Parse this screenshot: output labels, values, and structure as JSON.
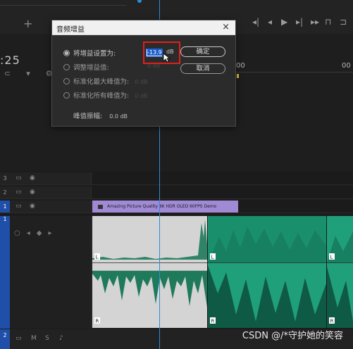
{
  "timeline": {
    "timecode_partial": ":25",
    "ruler_labels": [
      "00",
      "00"
    ],
    "clip_title": "Amazing Picture Quality 8K HDR OLED 60FPS Demo",
    "video_tracks": [
      "3",
      "2",
      "1"
    ],
    "audio_tracks": [
      "1",
      "2"
    ],
    "channel_labels": [
      "L",
      "R",
      "L",
      "R",
      "L",
      "R"
    ]
  },
  "dialog": {
    "title": "音频增益",
    "close_glyph": "×",
    "options": [
      {
        "label": "将增益设置为:",
        "selected": true
      },
      {
        "label": "调整增益值:",
        "selected": false
      },
      {
        "label": "标准化最大峰值为:",
        "value": "0 dB",
        "selected": false
      },
      {
        "label": "标准化所有峰值为:",
        "value": "0 dB",
        "selected": false
      }
    ],
    "gain_value": "-13.9",
    "gain_unit": "dB",
    "adjust_value": "0 dB",
    "peak_label": "峰值振幅:",
    "peak_value": "0.0 dB",
    "ok_label": "确定",
    "cancel_label": "取消"
  },
  "watermark": "CSDN @/*守护她的笑容",
  "colors": {
    "playhead": "#2a8dd9",
    "highlight_box": "#e0201c",
    "clip_video": "#a08ad6",
    "clip_audio_green": "#1fa07a",
    "clip_audio_selected": "#d4d4d4",
    "track_active": "#1f4fa8"
  }
}
